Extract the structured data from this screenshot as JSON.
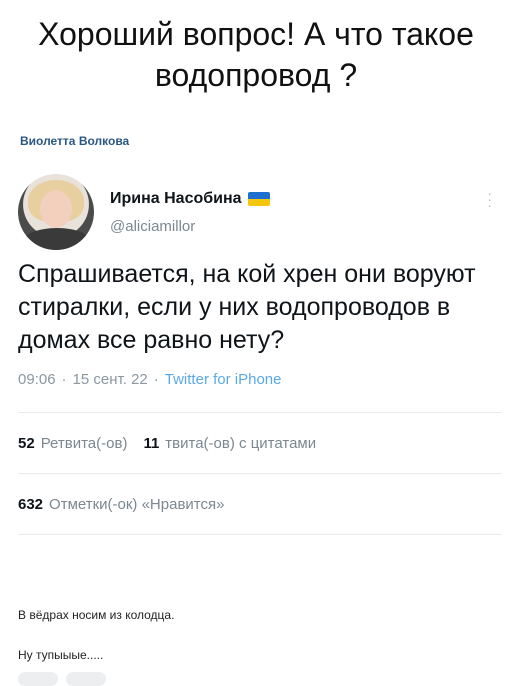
{
  "caption": "Хороший вопрос! А что такое водопровод ?",
  "author": "Виолетта Волкова",
  "tweet": {
    "display_name": "Ирина Насобина",
    "handle": "@aliciamillor",
    "text": "Спрашивается, на кой хрен они воруют стиралки, если у них водопроводов в домах все равно нету?",
    "time": "09:06",
    "date": "15 сент. 22",
    "source": "Twitter for iPhone",
    "sep": "·",
    "retweets": {
      "count": "52",
      "label": "Ретвита(-ов)"
    },
    "quotes": {
      "count": "11",
      "label": "твита(-ов) с цитатами"
    },
    "likes": {
      "count": "632",
      "label": "Отметки(-ок) «Нравится»"
    }
  },
  "comments": [
    "В вёдрах носим из колодца.",
    "Ну тупыыые....."
  ],
  "icons": {
    "more": "more-vertical-icon",
    "flag": "ukraine-flag-icon"
  }
}
